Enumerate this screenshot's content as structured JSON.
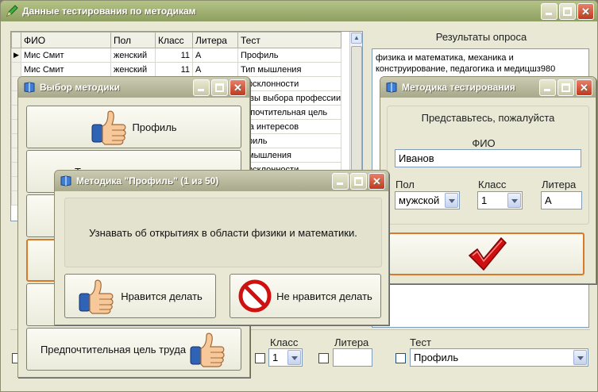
{
  "main": {
    "title": "Данные тестирования по методикам",
    "grid": {
      "columns": [
        "ФИО",
        "Пол",
        "Класс",
        "Литера",
        "Тест"
      ],
      "rows": [
        [
          "Мис Смит",
          "женский",
          "11",
          "А",
          "Профиль"
        ],
        [
          "Мис Смит",
          "женский",
          "11",
          "А",
          "Тип мышления"
        ],
        [
          "",
          "",
          "",
          "",
          "офсклонности"
        ],
        [
          "",
          "",
          "",
          "",
          "тивы выбора профессии"
        ],
        [
          "",
          "",
          "",
          "",
          "едпочтительная цель"
        ],
        [
          "",
          "",
          "",
          "",
          "рта интересов"
        ],
        [
          "",
          "",
          "",
          "",
          "офиль"
        ],
        [
          "",
          "",
          "",
          "",
          "п мышления"
        ],
        [
          "",
          "",
          "",
          "",
          "офсклонности"
        ],
        [
          "",
          "",
          "",
          "",
          ""
        ],
        [
          "",
          "",
          "",
          "",
          ""
        ]
      ]
    },
    "results_label": "Результаты опроса",
    "results_text": "физика и математика, механика и конструирование, педагогика и медицшз980",
    "filters": {
      "class_label": "Класс",
      "class_value": "1",
      "letter_label": "Литера",
      "letter_value": "",
      "test_label": "Тест",
      "test_value": "Профиль"
    }
  },
  "choose": {
    "title": "Выбор методики",
    "buttons": [
      "Профиль",
      "Т",
      "",
      "",
      "",
      "Предпочтительная цель труда"
    ]
  },
  "method": {
    "title": "Методика тестирования",
    "prompt": "Представьтесь, пожалуйста",
    "fio_label": "ФИО",
    "fio_value": "Иванов",
    "sex_label": "Пол",
    "sex_value": "мужской",
    "class_label": "Класс",
    "class_value": "1",
    "letter_label": "Литера",
    "letter_value": "А"
  },
  "profile": {
    "title": "Методика \"Профиль\" (1 из 50)",
    "question": "Узнавать об открытиях в области физики и математики.",
    "like_label": "Нравится делать",
    "dislike_label": "Не нравится делать"
  },
  "colors": {
    "accent_orange": "#d87a2a",
    "check_red": "#d01010"
  }
}
